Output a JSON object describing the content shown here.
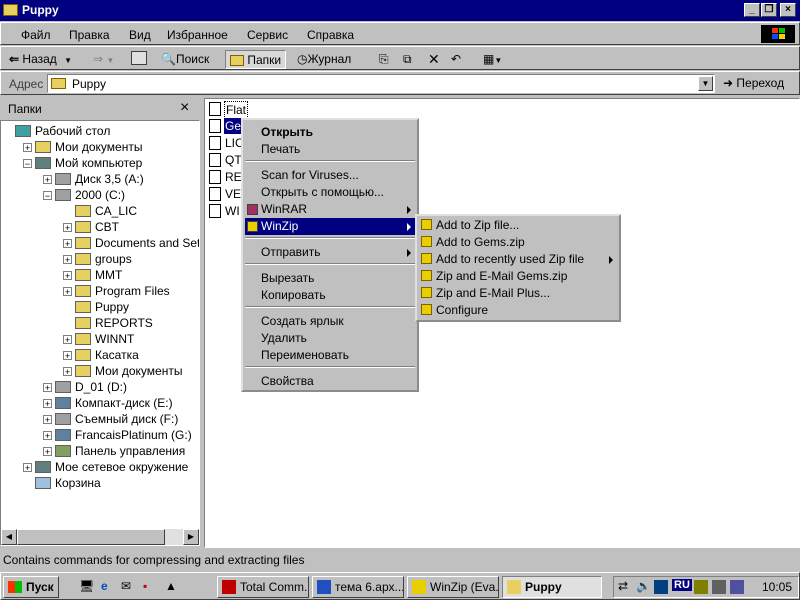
{
  "window": {
    "title": "Puppy"
  },
  "menubar": [
    "Файл",
    "Правка",
    "Вид",
    "Избранное",
    "Сервис",
    "Справка"
  ],
  "toolbar": {
    "back": "Назад",
    "search": "Поиск",
    "folders": "Папки",
    "history": "Журнал"
  },
  "address": {
    "label": "Адрес",
    "value": "Puppy",
    "go": "Переход"
  },
  "tree": {
    "title": "Папки",
    "close": "×",
    "items": [
      {
        "label": "Рабочий стол"
      },
      {
        "label": "Мои документы"
      },
      {
        "label": "Мой компьютер"
      },
      {
        "label": "Диск 3,5 (A:)"
      },
      {
        "label": "2000 (C:)"
      },
      {
        "label": "CA_LIC"
      },
      {
        "label": "CBT"
      },
      {
        "label": "Documents and Setti"
      },
      {
        "label": "groups"
      },
      {
        "label": "MMT"
      },
      {
        "label": "Program Files"
      },
      {
        "label": "Puppy"
      },
      {
        "label": "REPORTS"
      },
      {
        "label": "WINNT"
      },
      {
        "label": "Касатка"
      },
      {
        "label": "Мои документы"
      },
      {
        "label": "D_01 (D:)"
      },
      {
        "label": "Компакт-диск (E:)"
      },
      {
        "label": "Съемный диск (F:)"
      },
      {
        "label": "FrancaisPlatinum (G:)"
      },
      {
        "label": "Панель управления"
      },
      {
        "label": "Мое сетевое окружение"
      },
      {
        "label": "Корзина"
      }
    ]
  },
  "files": [
    "Flat",
    "Gen",
    "LIC",
    "QT",
    "RE",
    "VE",
    "WI"
  ],
  "context_menu": {
    "items": [
      "Открыть",
      "Печать",
      "Scan for Viruses...",
      "Открыть с помощью...",
      "WinRAR",
      "WinZip",
      "Отправить",
      "Вырезать",
      "Копировать",
      "Создать ярлык",
      "Удалить",
      "Переименовать",
      "Свойства"
    ]
  },
  "submenu": {
    "items": [
      "Add to Zip file...",
      "Add to Gems.zip",
      "Add to recently used Zip file",
      "Zip and E-Mail Gems.zip",
      "Zip and E-Mail Plus...",
      "Configure"
    ]
  },
  "status": {
    "text": "Contains commands for compressing and extracting files"
  },
  "taskbar": {
    "start": "Пуск",
    "tasks": [
      "Total Comm...",
      "тема 6.арх...",
      "WinZip (Eva...",
      "Puppy"
    ],
    "lang": "RU",
    "clock": "10:05"
  },
  "colors": {
    "titlebar": "#000080",
    "highlight": "#000080",
    "face": "#c0c0c0"
  }
}
